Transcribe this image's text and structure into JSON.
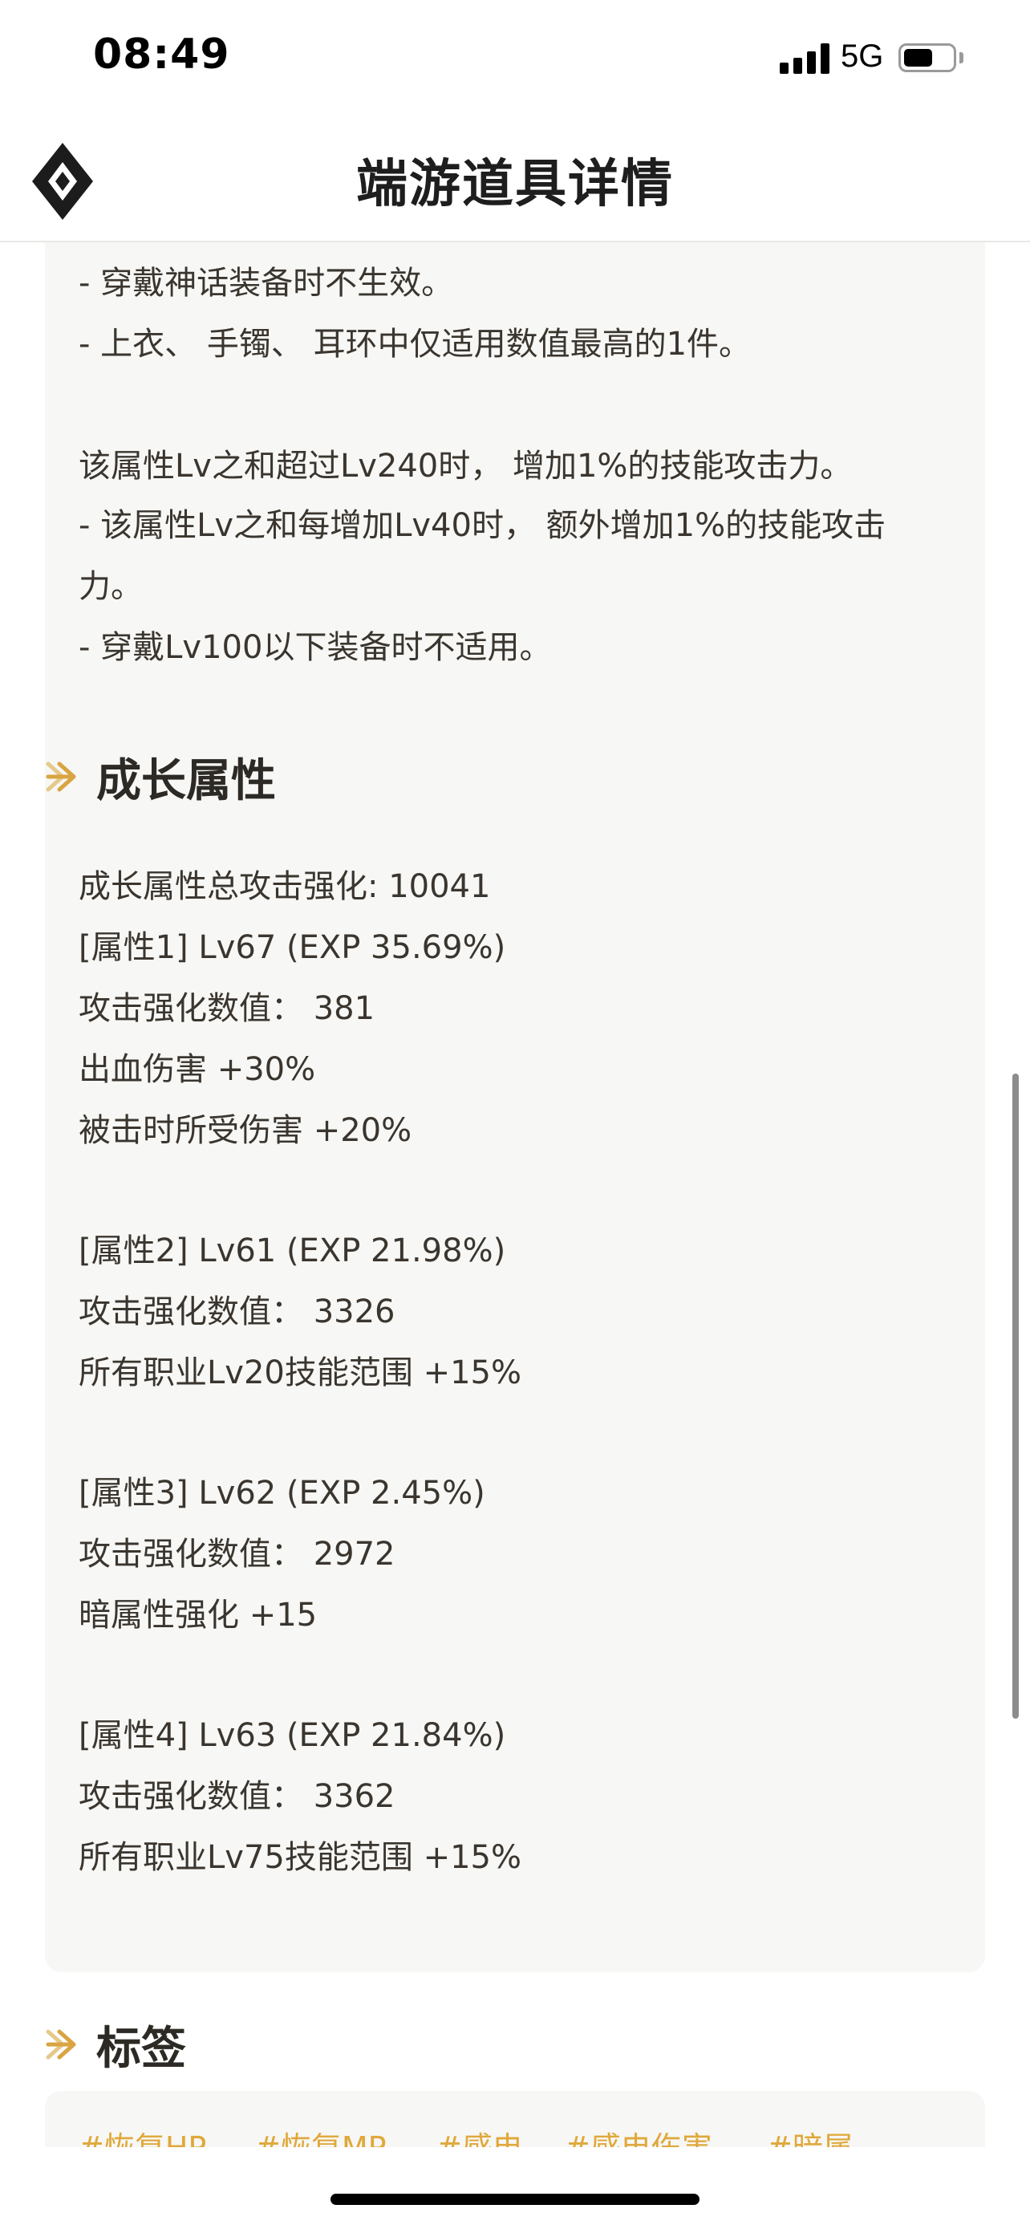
{
  "status_bar": {
    "time": "08:49",
    "network": "5G",
    "battery_level": 0.6
  },
  "header": {
    "title": "端游道具详情",
    "logo_icon": "diamond-logo-icon"
  },
  "description": {
    "lines": [
      "- 穿戴神话装备时不生效。",
      "- 上衣、 手镯、 耳环中仅适用数值最高的1件。",
      "该属性Lv之和超过Lv240时， 增加1%的技能攻击力。",
      "- 该属性Lv之和每增加Lv40时， 额外增加1%的技能攻击",
      "力。",
      "- 穿戴Lv100以下装备时不适用。"
    ]
  },
  "growth": {
    "section_title": "成长属性",
    "total_label": "成长属性总攻击强化: 10041",
    "attributes": [
      {
        "header": "[属性1] Lv67 (EXP 35.69%)",
        "attack": "攻击强化数值：  381",
        "effects": [
          "出血伤害 +30%",
          "被击时所受伤害 +20%"
        ]
      },
      {
        "header": "[属性2] Lv61 (EXP 21.98%)",
        "attack": "攻击强化数值：  3326",
        "effects": [
          "所有职业Lv20技能范围 +15%"
        ]
      },
      {
        "header": "[属性3] Lv62 (EXP 2.45%)",
        "attack": "攻击强化数值：  2972",
        "effects": [
          "暗属性强化 +15"
        ]
      },
      {
        "header": "[属性4] Lv63 (EXP 21.84%)",
        "attack": "攻击强化数值：  3362",
        "effects": [
          "所有职业Lv75技能范围 +15%"
        ]
      }
    ]
  },
  "tags": {
    "section_title": "标签",
    "items": [
      "#恢复HP",
      "#恢复MP",
      "#感电",
      "#感电伤害",
      "#暗属"
    ]
  },
  "colors": {
    "accent": "#d9a441",
    "card_bg": "#f7f7f5",
    "tag_text": "#e0a83a"
  }
}
